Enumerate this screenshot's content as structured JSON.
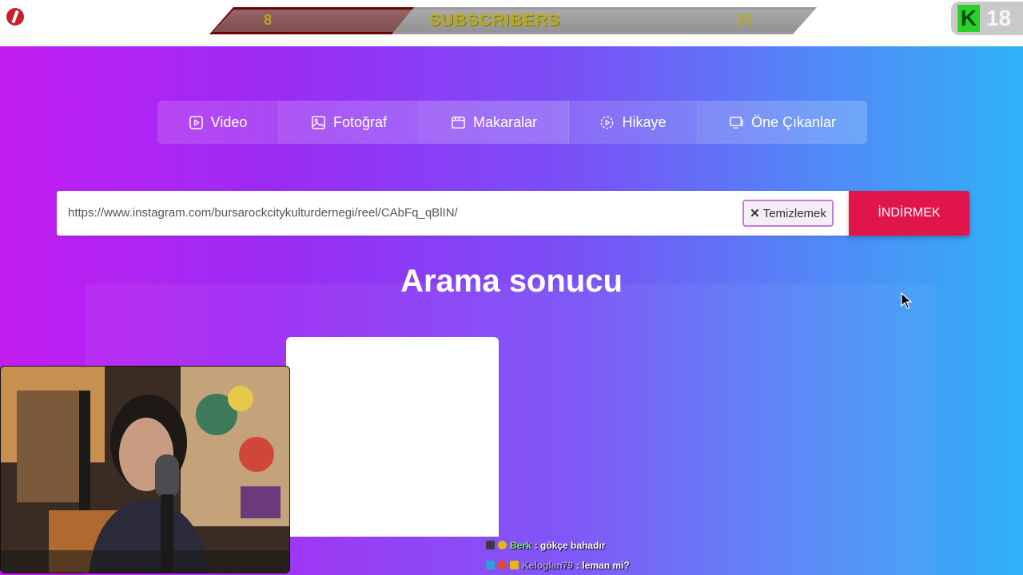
{
  "overlay": {
    "subscribers_left": "8",
    "subscribers_title": "SUBSCRIBERS",
    "subscribers_right": "25",
    "k_number": "18",
    "k_letter": "K"
  },
  "tabs": [
    {
      "label": "Video",
      "icon": "play-icon"
    },
    {
      "label": "Fotoğraf",
      "icon": "image-icon"
    },
    {
      "label": "Makaralar",
      "icon": "reels-icon"
    },
    {
      "label": "Hikaye",
      "icon": "story-icon"
    },
    {
      "label": "Öne Çıkanlar",
      "icon": "highlights-icon"
    }
  ],
  "search": {
    "value": "https://www.instagram.com/bursarockcitykulturdernegi/reel/CAbFq_qBlIN/",
    "clear_label": "Temizlemek",
    "download_label": "İNDİRMEK"
  },
  "results": {
    "title": "Arama sonucu"
  },
  "chat": [
    {
      "user": "Berk",
      "message": ": gökçe bahadır"
    },
    {
      "user": "Keloglan79",
      "message": ": leman mi?"
    }
  ],
  "colors": {
    "download_button": "#e0164a",
    "gradient_start": "#c21df0",
    "gradient_end": "#2fb2f7"
  }
}
